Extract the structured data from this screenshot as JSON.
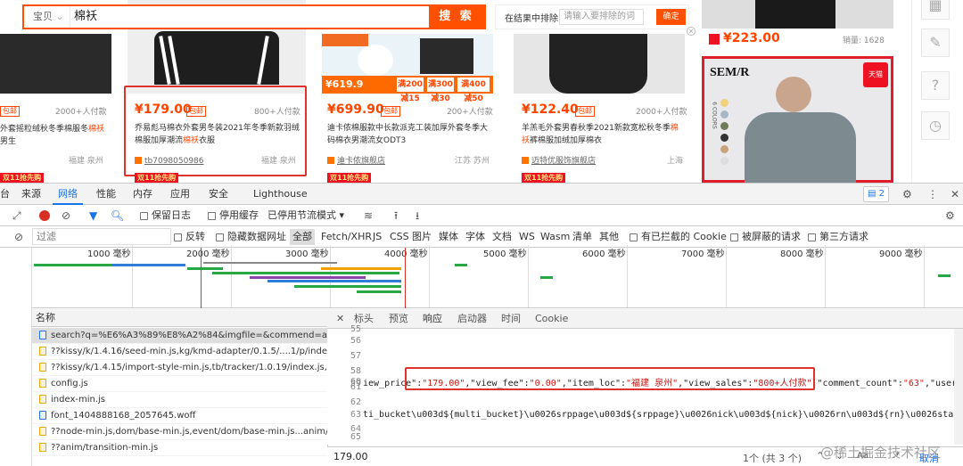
{
  "search": {
    "category": "宝贝",
    "query": "棉袄",
    "button": "搜 索"
  },
  "exclude": {
    "label": "在结果中排除",
    "placeholder": "请输入要排除的词",
    "confirm": "确定"
  },
  "products": [
    {
      "price": "",
      "sold": "2000+人付款",
      "title_a": "外套摇粒绒秋冬季棉服冬",
      "title_hl": "棉袄",
      "title_b": "男生",
      "location": "福建 泉州",
      "tag": "包邮"
    },
    {
      "price": "¥179.00",
      "tag": "包邮",
      "sold": "800+人付款",
      "title_a": "乔易彪马棉衣外套男冬装2021年冬季新款羽绒棉服加厚潮流",
      "title_hl": "棉袄",
      "title_b": "衣服",
      "shop": "tb7098050986",
      "location": "福建 泉州"
    },
    {
      "price": "¥699.90",
      "tag": "包邮",
      "sold": "200+人付款",
      "title_a": "迪卡侬棉服款中长款派克工装加厚外套冬季大码棉衣男潮流女ODT3",
      "title_hl": "",
      "title_b": "",
      "shop": "迪卡侬旗舰店",
      "location": "江苏 苏州",
      "promo_price": "¥619.9",
      "coupons": [
        "满200减15",
        "满300减30",
        "满400减50"
      ]
    },
    {
      "price": "¥122.40",
      "tag": "包邮",
      "sold": "2000+人付款",
      "title_a": "羊羔毛外套男春秋季2021新款宽松秋冬季",
      "title_hl": "棉袄",
      "title_b": "裤棉服加绒加厚棉衣",
      "shop": "迈特优服饰旗舰店",
      "location": "上海"
    },
    {
      "price": "¥223.00",
      "sold": "销量: 1628",
      "brand": "SEM/R",
      "colors_text": "6 COLORS",
      "tmall": "天猫"
    }
  ],
  "promo_badge": "双11抢先购",
  "devtools": {
    "tabs": [
      "台",
      "来源",
      "网络",
      "性能",
      "内存",
      "应用",
      "安全",
      "Lighthouse"
    ],
    "active_tab": "网络",
    "issues_count": "2",
    "toolbar": {
      "preserve_log": "保留日志",
      "disable_cache": "停用缓存",
      "throttle": "已停用节流模式"
    },
    "filter": {
      "placeholder": "过滤",
      "invert": "反转",
      "hide_data_urls": "隐藏数据网址",
      "types": [
        "全部",
        "Fetch/XHR",
        "JS",
        "CSS",
        "图片",
        "媒体",
        "字体",
        "文档",
        "WS",
        "Wasm",
        "清单",
        "其他"
      ],
      "blocked_cookies": "有已拦截的 Cookie",
      "blocked_requests": "被屏蔽的请求",
      "third_party": "第三方请求"
    },
    "timeline_ticks": [
      "1000 毫秒",
      "2000 毫秒",
      "3000 毫秒",
      "4000 毫秒",
      "5000 毫秒",
      "6000 毫秒",
      "7000 毫秒",
      "8000 毫秒",
      "9000 毫秒"
    ],
    "name_header": "名称",
    "requests": [
      {
        "name": "search?q=%E6%A3%89%E8%A2%84&imgfile=&commend=all...",
        "type": "doc",
        "selected": true
      },
      {
        "name": "??kissy/k/1.4.16/seed-min.js,kg/kmd-adapter/0.1.5/....1/p/index/",
        "type": "js"
      },
      {
        "name": "??kissy/k/1.4.15/import-style-min.js,tb/tracker/1.0.19/index.js,/t...",
        "type": "js"
      },
      {
        "name": "config.js",
        "type": "js"
      },
      {
        "name": "index-min.js",
        "type": "js"
      },
      {
        "name": "font_1404888168_2057645.woff",
        "type": "font"
      },
      {
        "name": "??node-min.js,dom/base-min.js,event/dom/base-min.js...anim/ba",
        "type": "js"
      },
      {
        "name": "??anim/transition-min.js",
        "type": "js"
      }
    ],
    "detail_tabs": [
      "标头",
      "预览",
      "响应",
      "启动器",
      "时间",
      "Cookie"
    ],
    "active_detail_tab": "响应",
    "code_lines": [
      {
        "num": "55",
        "text": ""
      },
      {
        "num": "56",
        "text": ""
      },
      {
        "num": "57",
        "text": ""
      },
      {
        "num": "58",
        "text": ""
      },
      {
        "num": "59",
        "text": ""
      },
      {
        "num": "60",
        "pre": "iew_price\":",
        "v1": "\"179.00\"",
        "m1": ",\"view_fee\":",
        "v2": "\"0.00\"",
        "m2": ",\"item_loc\":",
        "v3": "\"福建 泉州\"",
        "m3": ",\"view_sales\":",
        "v4": "\"800+人付款\"",
        "m4": ",\"comment_count\":",
        "v5": "\"63\"",
        "m5": ",\"user_id\""
      },
      {
        "num": "61",
        "text": ""
      },
      {
        "num": "62",
        "text": ""
      },
      {
        "num": "63",
        "text": "ti_bucket\\u003d${multi_bucket}\\u0026srppage\\u003d${srppage}\\u0026nick\\u003d${nick}\\u0026rn\\u003d${rn}\\u0026stats_cl"
      },
      {
        "num": "64",
        "text": ""
      },
      {
        "num": "65",
        "text": ""
      }
    ],
    "find": {
      "query": "179.00",
      "count": "1个 (共 3 个)",
      "cancel": "取消"
    }
  },
  "watermark": "@稀土掘金技术社区",
  "colors": {
    "accent": "#ff5000",
    "price": "#ff4400",
    "devtools_blue": "#1a73e8",
    "highlight_box": "#e0322a"
  }
}
